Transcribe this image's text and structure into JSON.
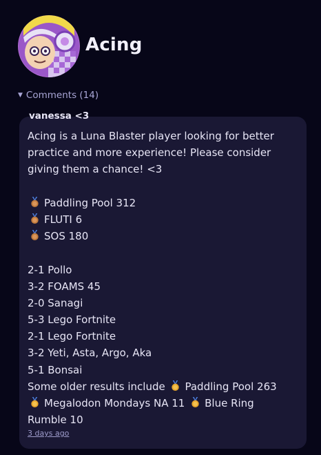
{
  "profile": {
    "name": "Acing",
    "avatar_icon": "avatar-image"
  },
  "comments": {
    "toggle_label": "Comments (14)",
    "toggle_icon": "caret-down-icon"
  },
  "comment": {
    "author": "vanessa <3",
    "timestamp": "3 days ago",
    "lines": {
      "intro_1": "Acing is a Luna Blaster player looking for better",
      "intro_2": "practice and more experience! Please consider",
      "intro_3": "giving them a chance! <3",
      "medal_1": "Paddling Pool 312",
      "medal_2": "FLUTI 6",
      "medal_3": "SOS 180",
      "result_1": "2-1 Pollo",
      "result_2": "3-2 FOAMS 45",
      "result_3": "2-0 Sanagi",
      "result_4": "5-3 Lego Fortnite",
      "result_5": "2-1 Lego Fortnite",
      "result_6": "3-2 Yeti, Asta, Argo, Aka",
      "result_7": "5-1 Bonsai",
      "older_prefix": "Some older results include",
      "older_1": "Paddling Pool 263",
      "older_2": "Megalodon Mondays NA 11",
      "older_3": "Blue Ring",
      "older_4": "Rumble 10"
    },
    "medal_icon": "bronze-medal-icon",
    "colors": {
      "card_bg": "#1a1834",
      "page_bg": "#070618",
      "medal_bronze": "#c07a3c",
      "medal_gold": "#e7a52b"
    }
  }
}
